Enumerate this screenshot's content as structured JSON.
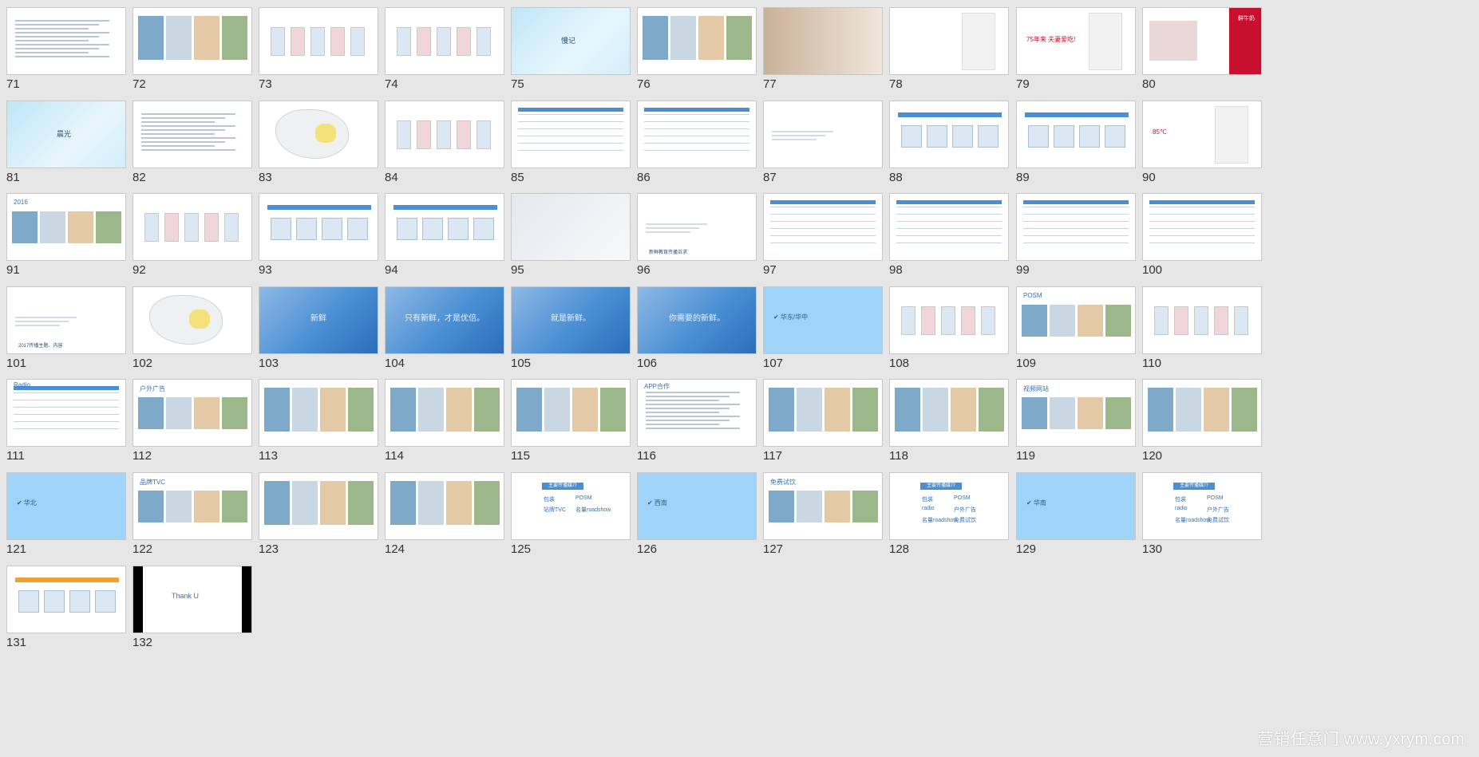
{
  "slides": [
    {
      "n": "71",
      "style": "doc",
      "label": ""
    },
    {
      "n": "72",
      "style": "photo",
      "label": ""
    },
    {
      "n": "73",
      "style": "products",
      "label": ""
    },
    {
      "n": "74",
      "style": "products",
      "label": ""
    },
    {
      "n": "75",
      "style": "blue",
      "label": "慢记"
    },
    {
      "n": "76",
      "style": "collage",
      "label": ""
    },
    {
      "n": "77",
      "style": "baby",
      "label": ""
    },
    {
      "n": "78",
      "style": "poster",
      "label": ""
    },
    {
      "n": "79",
      "style": "poster",
      "label": "75年来 夫妻爱吃!"
    },
    {
      "n": "80",
      "style": "redpanel",
      "label": "鲜牛奶"
    },
    {
      "n": "81",
      "style": "blue",
      "label": "晨光"
    },
    {
      "n": "82",
      "style": "doc",
      "label": ""
    },
    {
      "n": "83",
      "style": "map",
      "label": ""
    },
    {
      "n": "84",
      "style": "products",
      "label": ""
    },
    {
      "n": "85",
      "style": "table",
      "label": ""
    },
    {
      "n": "86",
      "style": "table",
      "label": ""
    },
    {
      "n": "87",
      "style": "bullets",
      "label": ""
    },
    {
      "n": "88",
      "style": "diagram",
      "label": ""
    },
    {
      "n": "89",
      "style": "timeline",
      "label": ""
    },
    {
      "n": "90",
      "style": "poster",
      "label": "85℃"
    },
    {
      "n": "91",
      "style": "collage",
      "label": "2016"
    },
    {
      "n": "92",
      "style": "products",
      "label": ""
    },
    {
      "n": "93",
      "style": "diagram",
      "label": ""
    },
    {
      "n": "94",
      "style": "chart",
      "label": ""
    },
    {
      "n": "95",
      "style": "grey",
      "label": ""
    },
    {
      "n": "96",
      "style": "bullets",
      "label": "新鲜教育传播诉求"
    },
    {
      "n": "97",
      "style": "table",
      "label": ""
    },
    {
      "n": "98",
      "style": "table",
      "label": ""
    },
    {
      "n": "99",
      "style": "table",
      "label": ""
    },
    {
      "n": "100",
      "style": "table",
      "label": ""
    },
    {
      "n": "101",
      "style": "bullets",
      "label": "2017传播主题、内容"
    },
    {
      "n": "102",
      "style": "map",
      "label": ""
    },
    {
      "n": "103",
      "style": "poly",
      "label": "新鲜"
    },
    {
      "n": "104",
      "style": "poly",
      "label": "只有新鲜，才是优倍。"
    },
    {
      "n": "105",
      "style": "poly",
      "label": "就是新鲜。"
    },
    {
      "n": "106",
      "style": "poly",
      "label": "你需要的新鲜。"
    },
    {
      "n": "107",
      "style": "lightblue",
      "label": "华东/华中"
    },
    {
      "n": "108",
      "style": "products",
      "label": ""
    },
    {
      "n": "109",
      "style": "photo",
      "label": "POSM"
    },
    {
      "n": "110",
      "style": "products",
      "label": ""
    },
    {
      "n": "111",
      "style": "table",
      "label": "Radio"
    },
    {
      "n": "112",
      "style": "photo",
      "label": "户外广告"
    },
    {
      "n": "113",
      "style": "photo",
      "label": ""
    },
    {
      "n": "114",
      "style": "photo",
      "label": ""
    },
    {
      "n": "115",
      "style": "collage",
      "label": ""
    },
    {
      "n": "116",
      "style": "doc",
      "label": "APP合作"
    },
    {
      "n": "117",
      "style": "collage",
      "label": ""
    },
    {
      "n": "118",
      "style": "photo",
      "label": ""
    },
    {
      "n": "119",
      "style": "photo",
      "label": "视频网站"
    },
    {
      "n": "120",
      "style": "photo",
      "label": ""
    },
    {
      "n": "121",
      "style": "lightblue",
      "label": "华北"
    },
    {
      "n": "122",
      "style": "photo",
      "label": "品牌TVC"
    },
    {
      "n": "123",
      "style": "photo",
      "label": ""
    },
    {
      "n": "124",
      "style": "photo",
      "label": ""
    },
    {
      "n": "125",
      "style": "tags",
      "label": "主要传播媒介"
    },
    {
      "n": "126",
      "style": "lightblue",
      "label": "西南"
    },
    {
      "n": "127",
      "style": "photo",
      "label": "免费试饮"
    },
    {
      "n": "128",
      "style": "tags",
      "label": "主要传播媒介"
    },
    {
      "n": "129",
      "style": "lightblue",
      "label": "华南"
    },
    {
      "n": "130",
      "style": "tags",
      "label": "主要传播媒介"
    },
    {
      "n": "131",
      "style": "orgchart",
      "label": ""
    },
    {
      "n": "132",
      "style": "dark",
      "label": "Thank U"
    }
  ],
  "tags_125": [
    "包装",
    "POSM",
    "站牌TVC",
    "名量roadshow"
  ],
  "tags_128": [
    "包装",
    "POSM",
    "radio",
    "户外广告",
    "名量roadshow",
    "免费试饮"
  ],
  "tags_130": [
    "包装",
    "POSM",
    "radio",
    "户外广告",
    "名量roadshow",
    "免费试饮"
  ],
  "watermark": "营销任意门 www.yxrym.com",
  "colors": {
    "background": "#e6e6e6",
    "slide_blue": "#4a8fd4",
    "light_blue": "#9fd3f7",
    "accent_red": "#c8102e"
  }
}
